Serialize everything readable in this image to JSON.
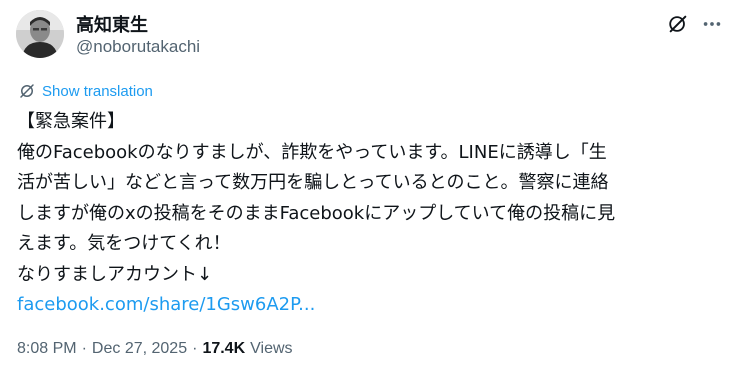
{
  "author": {
    "display_name": "高知東生",
    "handle": "@noborutakachi"
  },
  "header_icons": [
    "grok-icon",
    "more-icon"
  ],
  "translate": {
    "label": "Show translation",
    "icon": "translate-icon"
  },
  "tweet": {
    "lines": [
      "【緊急案件】",
      "俺のFacebookのなりすましが、詐欺をやっています。LINEに誘導し「生",
      "活が苦しい」などと言って数万円を騙しとっているとのこと。警察に連絡",
      "しますが俺のxの投稿をそのままFacebookにアップしていて俺の投稿に見",
      "えます。気をつけてくれ！",
      "なりすましアカウント↓"
    ],
    "link_text": "facebook.com/share/1Gsw6A2P..."
  },
  "meta": {
    "time": "8:08 PM",
    "separator": "·",
    "date": "Dec 27, 2025",
    "views_count": "17.4K",
    "views_label": "Views"
  },
  "colors": {
    "text": "#0f1419",
    "secondary": "#536471",
    "accent": "#1d9bf0"
  }
}
